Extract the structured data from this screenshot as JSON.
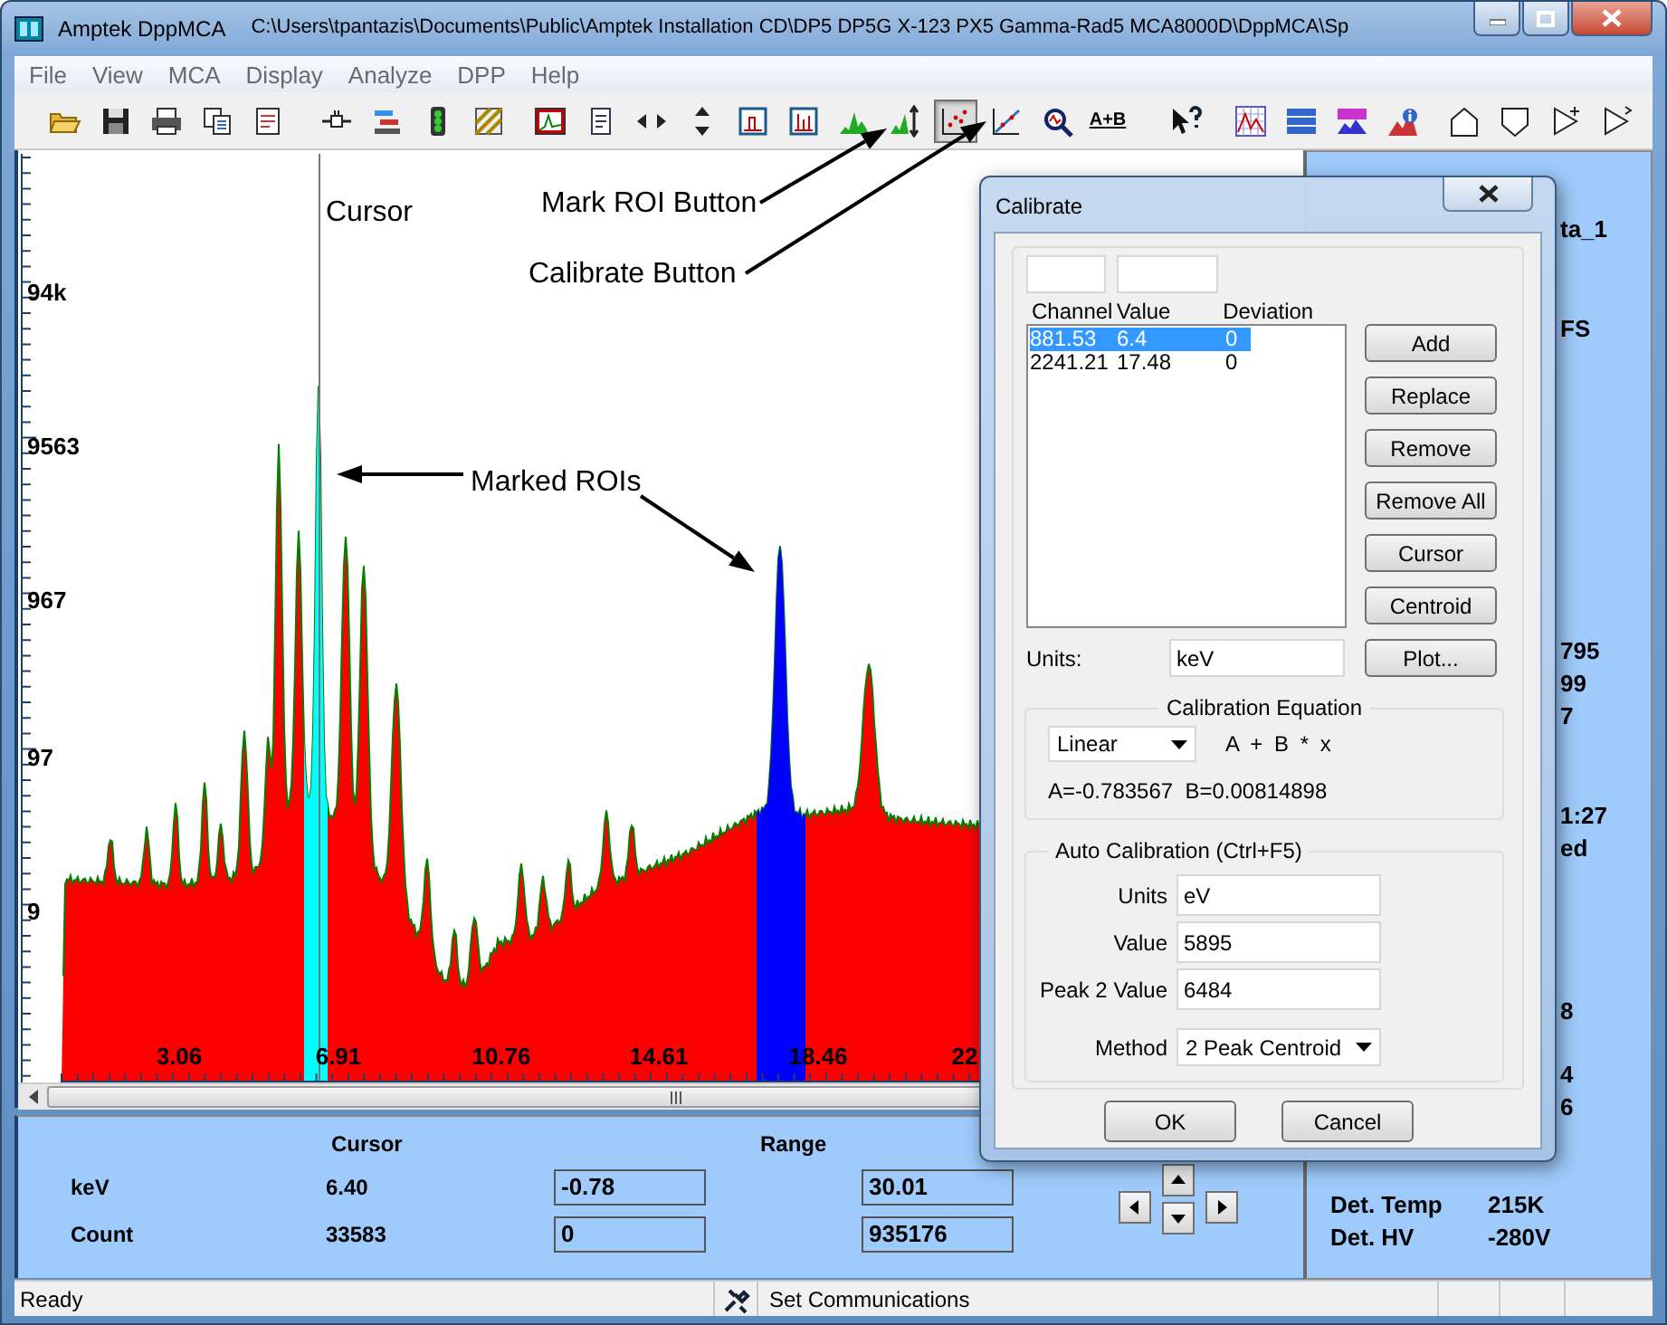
{
  "window": {
    "app_name": "Amptek DppMCA",
    "path": "C:\\Users\\tpantazis\\Documents\\Public\\Amptek Installation CD\\DP5 DP5G X-123 PX5 Gamma-Rad5 MCA8000D\\DppMCA\\Sp"
  },
  "menu": [
    "File",
    "View",
    "MCA",
    "Display",
    "Analyze",
    "DPP",
    "Help"
  ],
  "toolbar": [
    [
      {
        "pressed": false
      },
      {
        "pressed": false
      },
      {
        "pressed": false
      },
      {
        "pressed": false
      },
      {
        "pressed": false
      }
    ],
    [
      {
        "pressed": false
      },
      {
        "pressed": false
      },
      {
        "pressed": false
      },
      {
        "pressed": false
      }
    ],
    [
      {
        "pressed": false
      },
      {
        "pressed": false
      },
      {
        "pressed": false
      },
      {
        "pressed": false
      },
      {
        "pressed": false
      },
      {
        "pressed": false
      },
      {
        "pressed": false
      },
      {
        "pressed": false
      },
      {
        "pressed": true
      },
      {
        "pressed": false
      },
      {
        "pressed": false
      },
      {
        "pressed": false,
        "label": "A+B"
      }
    ],
    [
      {
        "pressed": false
      }
    ],
    [
      {
        "pressed": false
      },
      {
        "pressed": false
      },
      {
        "pressed": false
      },
      {
        "pressed": false
      }
    ],
    [
      {
        "pressed": false
      },
      {
        "pressed": false
      },
      {
        "pressed": false
      },
      {
        "pressed": false
      }
    ]
  ],
  "plot": {
    "y_labels": [
      "94k",
      "9563",
      "967",
      "97",
      "9"
    ],
    "x_labels": [
      "3.06",
      "6.91",
      "10.76",
      "14.61",
      "18.46",
      "22"
    ],
    "cursor_label": "Cursor",
    "rois": [
      {
        "color": "#00ffff"
      },
      {
        "color": "#0000ff"
      }
    ]
  },
  "annotations": [
    {
      "text": "Mark ROI Button"
    },
    {
      "text": "Calibrate Button"
    },
    {
      "text": "Marked ROIs"
    }
  ],
  "readout": {
    "headers": [
      "Cursor",
      "Range"
    ],
    "rows": [
      {
        "label": "keV",
        "cursor": "6.40",
        "range_from": "-0.78",
        "range_to": "30.01"
      },
      {
        "label": "Count",
        "cursor": "33583",
        "range_from": "0",
        "range_to": "935176"
      }
    ]
  },
  "side_panel": {
    "fragments": [
      "ta_1",
      "FS",
      "795",
      "99",
      "7",
      "1:27",
      "ed",
      "8",
      "4",
      "6"
    ],
    "rows": [
      {
        "label": "Det. Temp",
        "value": "215K"
      },
      {
        "label": "Det. HV",
        "value": "-280V"
      }
    ]
  },
  "status_bar": {
    "message": "Ready",
    "connection": "Set Communications"
  },
  "dialog": {
    "title": "Calibrate",
    "columns": [
      "Channel",
      "Value",
      "Deviation"
    ],
    "points": [
      {
        "channel": "881.53",
        "value": "6.4",
        "deviation": "0",
        "selected": true
      },
      {
        "channel": "2241.21",
        "value": "17.48",
        "deviation": "0",
        "selected": false
      }
    ],
    "buttons": [
      "Add",
      "Replace",
      "Remove",
      "Remove All",
      "Cursor",
      "Centroid",
      "Plot..."
    ],
    "units_label": "Units:",
    "units": "keV",
    "equation": {
      "legend": "Calibration Equation",
      "type": "Linear",
      "formula": "A + B * x",
      "coefficients": "A=-0.783567  B=0.00814898"
    },
    "auto": {
      "legend": "Auto Calibration (Ctrl+F5)",
      "fields": [
        {
          "label": "Units",
          "value": "eV",
          "kind": "text"
        },
        {
          "label": "Value",
          "value": "5895",
          "kind": "text"
        },
        {
          "label": "Peak 2 Value",
          "value": "6484",
          "kind": "text"
        },
        {
          "label": "Method",
          "value": "2 Peak Centroid",
          "kind": "select"
        }
      ]
    },
    "actions": [
      "OK",
      "Cancel"
    ]
  }
}
